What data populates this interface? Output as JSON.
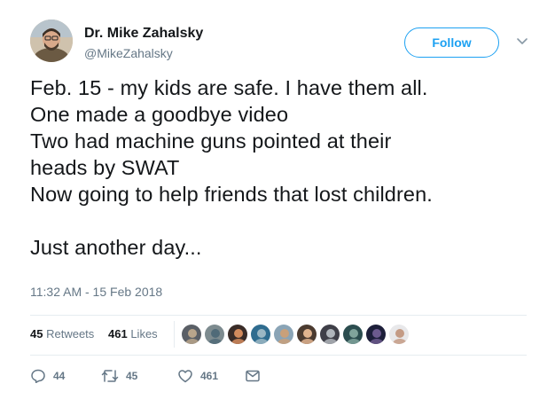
{
  "author": {
    "display_name": "Dr. Mike Zahalsky",
    "handle": "@MikeZahalsky",
    "avatar_icon": "profile-photo"
  },
  "follow": {
    "label": "Follow",
    "accent": "#1da1f2"
  },
  "tweet": {
    "lines": [
      "Feb. 15 - my kids are safe. I have them all.",
      "One made a goodbye video",
      "Two had machine guns pointed at their",
      "heads by SWAT",
      "Now going to help friends that lost children.",
      "",
      "Just another day..."
    ],
    "timestamp": "11:32 AM - 15 Feb 2018"
  },
  "stats": {
    "retweets_count": "45",
    "retweets_label": "Retweets",
    "likes_count": "461",
    "likes_label": "Likes",
    "liker_avatar_count": 10
  },
  "actions": {
    "reply_count": "44",
    "retweet_count": "45",
    "like_count": "461",
    "icons": [
      "reply-icon",
      "retweet-icon",
      "like-icon",
      "direct-message-icon"
    ]
  },
  "colors": {
    "text": "#14171a",
    "secondary": "#657786",
    "divider": "#e6ecf0"
  }
}
